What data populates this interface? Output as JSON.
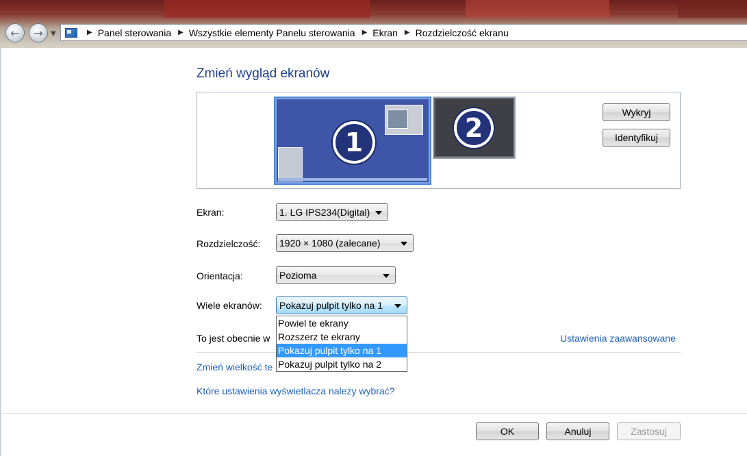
{
  "breadcrumb": {
    "items": [
      "Panel sterowania",
      "Wszystkie elementy Panelu sterowania",
      "Ekran",
      "Rozdzielczość ekranu"
    ]
  },
  "page": {
    "title": "Zmień wygląd ekranów"
  },
  "monitors": {
    "one_label": "1",
    "two_label": "2"
  },
  "buttons": {
    "detect": "Wykryj",
    "identify": "Identyfikuj",
    "ok": "OK",
    "cancel": "Anuluj",
    "apply": "Zastosuj"
  },
  "fields": {
    "display_label": "Ekran:",
    "display_value": "1. LG IPS234(Digital)",
    "resolution_label": "Rozdzielczość:",
    "resolution_value": "1920 × 1080 (zalecane)",
    "orientation_label": "Orientacja:",
    "orientation_value": "Pozioma",
    "multi_label": "Wiele ekranów:",
    "multi_value": "Pokazuj pulpit tylko na 1"
  },
  "multi_options": [
    "Powiel te ekrany",
    "Rozszerz te ekrany",
    "Pokazuj pulpit tylko na 1",
    "Pokazuj pulpit tylko na 2"
  ],
  "text": {
    "current_display_partial": "To jest obecnie w",
    "advanced_settings": "Ustawienia zaawansowane",
    "change_size_partial": "Zmień wielkość te",
    "which_settings": "Które ustawienia wyświetlacza należy wybrać?"
  },
  "icons": {
    "back": "back-arrow-icon",
    "forward": "forward-arrow-icon",
    "control_panel": "control-panel-icon"
  }
}
